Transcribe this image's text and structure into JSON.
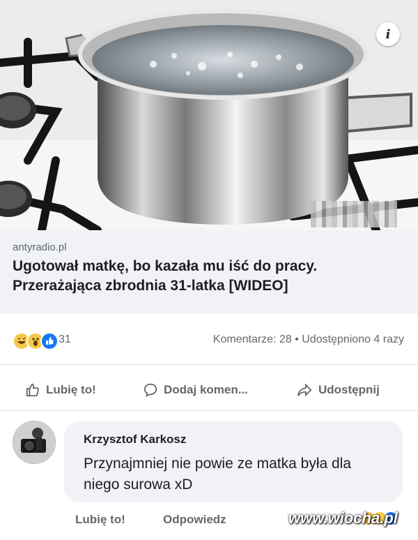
{
  "hero": {
    "icon": "info-icon",
    "icon_glyph": "i"
  },
  "link": {
    "domain": "antyradio.pl",
    "title": "Ugotował matkę, bo kazała mu iść do pracy. Przerażająca zbrodnia 31-latka [WIDEO]"
  },
  "reactions": {
    "icons": [
      "laughing-emoji-icon",
      "wow-emoji-icon",
      "like-icon"
    ],
    "count": "31",
    "stats": "Komentarze: 28 • Udostępniono 4 razy"
  },
  "actions": {
    "like": "Lubię to!",
    "comment": "Dodaj komen...",
    "share": "Udostępnij"
  },
  "comment": {
    "author": "Krzysztof Karkosz",
    "text": "Przynajmniej nie powie ze matka była dla niego surowa xD",
    "like": "Lubię to!",
    "reply": "Odpowiedz"
  },
  "watermark": "www.wiocha.pl",
  "colors": {
    "secondary_text": "#65676b",
    "bubble": "#f0f2f5",
    "like_blue": "#1877f2"
  }
}
